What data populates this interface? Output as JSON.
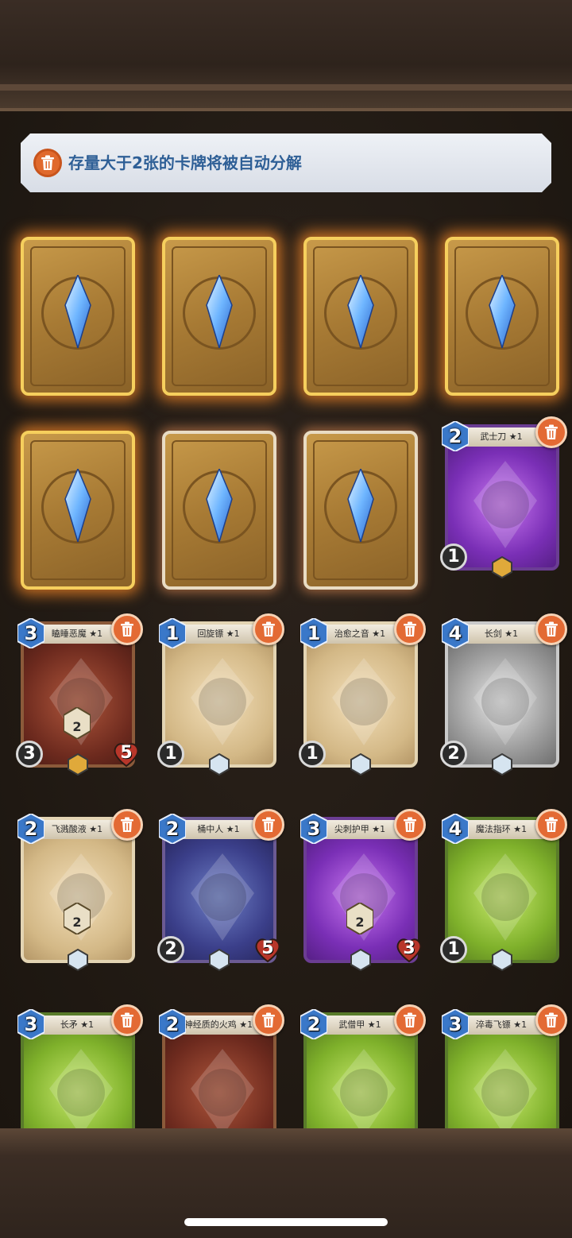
{
  "banner": {
    "text": "存量大于2张的卡牌将被自动分解",
    "icon": "trash-icon"
  },
  "card_backs": [
    {
      "style": "gold"
    },
    {
      "style": "gold"
    },
    {
      "style": "gold"
    },
    {
      "style": "gold"
    },
    {
      "style": "gold"
    },
    {
      "style": "silver"
    },
    {
      "style": "silver"
    }
  ],
  "cards": [
    {
      "name": "武士刀 ★1",
      "cost": "2",
      "rarity": "purple",
      "atk": "1",
      "hp": "",
      "badge": "",
      "bottom": "gold"
    },
    {
      "name": "瞌睡恶魔 ★1",
      "cost": "3",
      "rarity": "red",
      "atk": "3",
      "hp": "5",
      "badge": "2",
      "bottom": "gold"
    },
    {
      "name": "回旋镖 ★1",
      "cost": "1",
      "rarity": "tan",
      "atk": "1",
      "hp": "",
      "badge": "",
      "bottom": "silver"
    },
    {
      "name": "治愈之音 ★1",
      "cost": "1",
      "rarity": "tan",
      "atk": "1",
      "hp": "",
      "badge": "",
      "bottom": "silver"
    },
    {
      "name": "长剑 ★1",
      "cost": "4",
      "rarity": "gray",
      "atk": "2",
      "hp": "",
      "badge": "",
      "bottom": "silver"
    },
    {
      "name": "飞溅酸液 ★1",
      "cost": "2",
      "rarity": "tan",
      "atk": "",
      "hp": "",
      "badge": "2",
      "bottom": "silver"
    },
    {
      "name": "桶中人 ★1",
      "cost": "2",
      "rarity": "blue",
      "atk": "2",
      "hp": "5",
      "badge": "",
      "bottom": "silver"
    },
    {
      "name": "尖刺护甲 ★1",
      "cost": "3",
      "rarity": "purple",
      "atk": "",
      "hp": "3",
      "badge": "2",
      "bottom": "silver"
    },
    {
      "name": "魔法指环 ★1",
      "cost": "4",
      "rarity": "green",
      "atk": "1",
      "hp": "",
      "badge": "",
      "bottom": "silver"
    },
    {
      "name": "长矛 ★1",
      "cost": "3",
      "rarity": "green",
      "atk": "",
      "hp": "",
      "badge": "",
      "bottom": "silver"
    },
    {
      "name": "神经质的火鸡 ★1",
      "cost": "2",
      "rarity": "red",
      "atk": "",
      "hp": "",
      "badge": "",
      "bottom": "silver"
    },
    {
      "name": "武僧甲 ★1",
      "cost": "2",
      "rarity": "green",
      "atk": "",
      "hp": "",
      "badge": "",
      "bottom": "silver"
    },
    {
      "name": "淬毒飞镖 ★1",
      "cost": "3",
      "rarity": "green",
      "atk": "",
      "hp": "",
      "badge": "",
      "bottom": "silver"
    }
  ],
  "colors": {
    "banner_text": "#2e5f96",
    "trash": "#e36a34",
    "cost_gem": "#3a78c9",
    "hp_heart": "#b8362a"
  }
}
